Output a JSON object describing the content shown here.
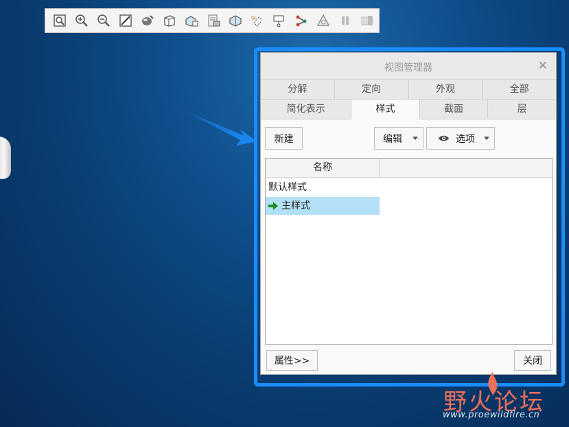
{
  "toolbar": {
    "icons": [
      "zoom-fit-icon",
      "zoom-in-icon",
      "zoom-out-icon",
      "repaint-icon",
      "shading-icon",
      "display-style-icon",
      "saved-orientations-icon",
      "view-manager-icon",
      "section-icon",
      "datum-display-icon",
      "annotation-display-icon",
      "spin-center-icon",
      "perspective-icon",
      "pause-icon",
      "view-icon"
    ]
  },
  "dialog": {
    "title": "视图管理器",
    "close_symbol": "×",
    "tabs_row1": [
      "分解",
      "定向",
      "外观",
      "全部"
    ],
    "tabs_row2": [
      "简化表示",
      "样式",
      "截面",
      "层"
    ],
    "active_tab": "样式",
    "buttons": {
      "new": "新建",
      "edit": "编辑",
      "options": "选项",
      "properties": "属性>>",
      "close": "关闭"
    },
    "list": {
      "column_header": "名称",
      "items": [
        "默认样式",
        "主样式"
      ],
      "selected": "主样式"
    }
  },
  "watermark": {
    "text": "野火论坛",
    "url": "www.proewildfire.cn"
  },
  "colors": {
    "highlight": "#1a8dff",
    "selection": "#b3e0f7",
    "background": "#0e4d8a"
  }
}
